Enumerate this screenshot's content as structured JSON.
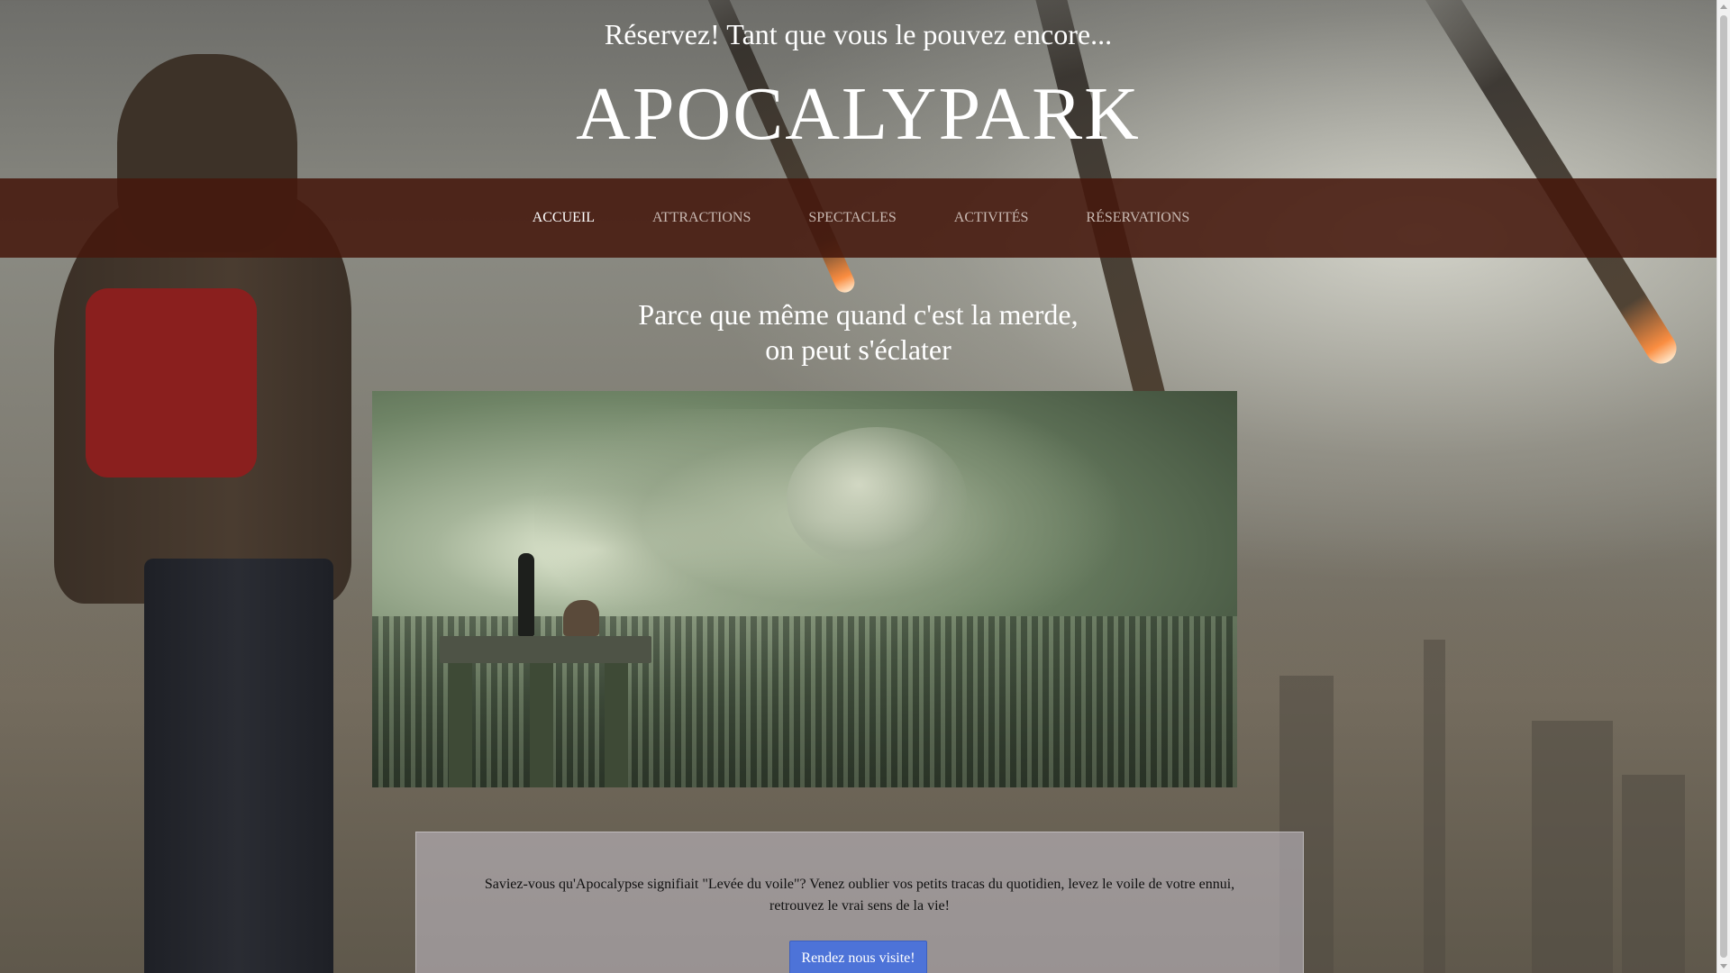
{
  "header": {
    "tagline": "Réservez! Tant que vous le pouvez encore...",
    "site_title": "APOCALYPARK"
  },
  "nav": {
    "items": [
      {
        "label": "ACCUEIL",
        "active": true
      },
      {
        "label": "ATTRACTIONS",
        "active": false
      },
      {
        "label": "SPECTACLES",
        "active": false
      },
      {
        "label": "ACTIVITÉS",
        "active": false
      },
      {
        "label": "RÉSERVATIONS",
        "active": false
      }
    ]
  },
  "hero": {
    "slogan_line1": "Parce que même quand c'est la merde,",
    "slogan_line2": "on peut s'éclater"
  },
  "card": {
    "text": "Saviez-vous qu'Apocalypse signifiait \"Levée du voile\"? Venez oublier vos petits tracas du quotidien, levez le voile de votre ennui, retrouvez le vrai sens de la vie!",
    "button_label": "Rendez nous visite!"
  },
  "colors": {
    "nav_background": "#46180c",
    "button": "#4d73d8",
    "text_light": "#ffffff"
  }
}
